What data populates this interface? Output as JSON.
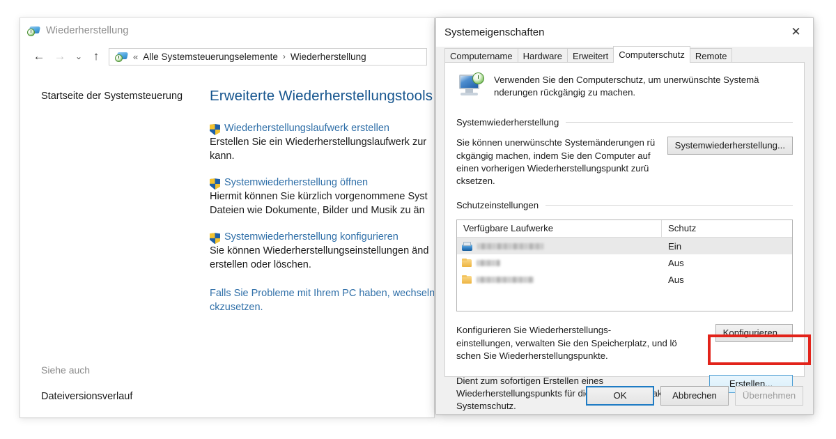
{
  "explorer": {
    "title": "Wiederherstellung",
    "title_icon": "recovery-icon",
    "nav": {
      "back": "←",
      "forward": "→",
      "recent": "⌄",
      "up": "↑"
    },
    "address": {
      "icon": "recovery-icon",
      "chevrons": "«",
      "crumb1": "Alle Systemsteuerungselemente",
      "separator": "›",
      "crumb2": "Wiederherstellung"
    },
    "sidebar": {
      "home_link": "Startseite der Systemsteuerung",
      "see_also_label": "Siehe auch",
      "see_also_item": "Dateiversionsverlauf"
    },
    "content": {
      "heading": "Erweiterte Wiederherstellungstools",
      "tasks": [
        {
          "icon": "shield-icon",
          "title": "Wiederherstellungslaufwerk erstellen",
          "desc": "Erstellen Sie ein Wiederherstellungslaufwerk zur\nkann."
        },
        {
          "icon": "shield-icon",
          "title": "Systemwiederherstellung öffnen",
          "desc": "Hiermit können Sie kürzlich vorgenommene Syst\nDateien wie Dokumente, Bilder und Musik zu än"
        },
        {
          "icon": "shield-icon",
          "title": "Systemwiederherstellung konfigurieren",
          "desc": "Sie können Wiederherstellungseinstellungen änd\nerstellen oder löschen."
        }
      ],
      "bottom_link": "Falls Sie Probleme mit Ihrem PC haben, wechseln\nckzusetzen."
    }
  },
  "dialog": {
    "title": "Systemeigenschaften",
    "close_label": "✕",
    "tabs": [
      {
        "label": "Computername",
        "active": false
      },
      {
        "label": "Hardware",
        "active": false
      },
      {
        "label": "Erweitert",
        "active": false
      },
      {
        "label": "Computerschutz",
        "active": true
      },
      {
        "label": "Remote",
        "active": false
      }
    ],
    "intro": {
      "icon": "computer-restore-icon",
      "text": "Verwenden Sie den Computerschutz, um unerwünschte Systemä\nnderungen rückgängig zu machen."
    },
    "system_restore": {
      "group_label": "Systemwiederherstellung",
      "text": "Sie können unerwünschte Systemänderungen rü\nckgängig machen, indem Sie den Computer auf\neinen vorherigen Wiederherstellungspunkt zurü\ncksetzen.",
      "button": "Systemwiederherstellung..."
    },
    "protection_settings": {
      "group_label": "Schutzeinstellungen",
      "columns": [
        "Verfügbare Laufwerke",
        "Schutz"
      ],
      "rows": [
        {
          "icon": "drive-icon",
          "name": "",
          "redacted": true,
          "redacted_width": 96,
          "protection": "Ein",
          "selected": true
        },
        {
          "icon": "folder-icon",
          "name": "",
          "redacted": true,
          "redacted_width": 34,
          "protection": "Aus",
          "selected": false
        },
        {
          "icon": "folder-icon",
          "name": "",
          "redacted": true,
          "redacted_width": 82,
          "protection": "Aus",
          "selected": false
        }
      ],
      "configure": {
        "text": "Konfigurieren Sie Wiederherstellungs-\neinstellungen, verwalten Sie den Speicherplatz, und lö\nschen Sie Wiederherstellungspunkte.",
        "button": "Konfigurieren..."
      },
      "create": {
        "text": "Dient zum sofortigen Erstellen eines\nWiederherstellungspunkts für die Laufwerke mit aktiviertem\nSystemschutz.",
        "button": "Erstellen...",
        "highlighted": true
      }
    },
    "footer": {
      "ok": "OK",
      "cancel": "Abbrechen",
      "apply": "Übernehmen",
      "apply_disabled": true
    }
  },
  "colors": {
    "link_blue": "#2f6fa8",
    "heading_blue": "#16558e",
    "highlight_red": "#e2231a",
    "focus_blue": "#1e7bc4",
    "dialog_bg": "#f0f0f0"
  }
}
